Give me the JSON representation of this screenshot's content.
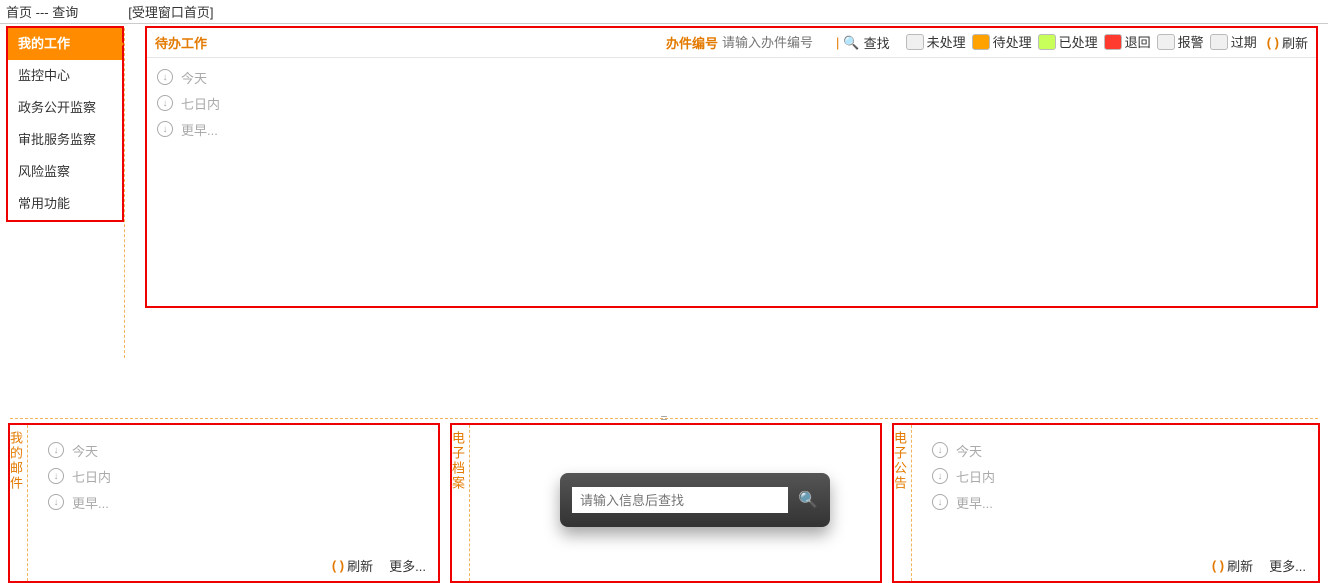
{
  "top": {
    "crumb": "首页 --- 查询",
    "tab": "[受理窗口首页]"
  },
  "sidebar": {
    "items": [
      "我的工作",
      "监控中心",
      "政务公开监察",
      "审批服务监察",
      "风险监察",
      "常用功能"
    ]
  },
  "work": {
    "title": "待办工作",
    "case_label": "办件编号",
    "case_placeholder": "请输入办件编号",
    "find": "查找",
    "statuses": [
      {
        "label": "未处理",
        "color": "#f0f0f0"
      },
      {
        "label": "待处理",
        "color": "#ffa200"
      },
      {
        "label": "已处理",
        "color": "#c8ff5a"
      },
      {
        "label": "退回",
        "color": "#ff3b2f"
      },
      {
        "label": "报警",
        "color": "#f0f0f0"
      },
      {
        "label": "过期",
        "color": "#f0f0f0"
      }
    ],
    "refresh": "刷新",
    "times": [
      "今天",
      "七日内",
      "更早..."
    ]
  },
  "cards": {
    "mail": {
      "title": "我的邮件",
      "times": [
        "今天",
        "七日内",
        "更早..."
      ],
      "refresh": "刷新",
      "more": "更多..."
    },
    "archive": {
      "title": "电子档案",
      "placeholder": "请输入信息后查找"
    },
    "notice": {
      "title": "电子公告",
      "times": [
        "今天",
        "七日内",
        "更早..."
      ],
      "refresh": "刷新",
      "more": "更多..."
    }
  }
}
